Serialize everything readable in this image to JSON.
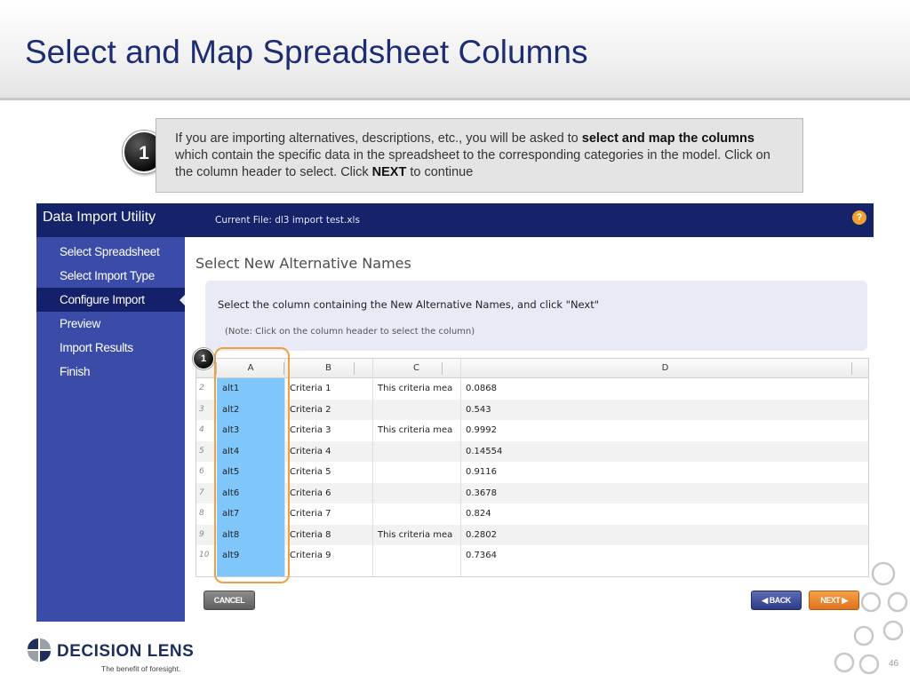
{
  "slide": {
    "title": "Select and Map Spreadsheet Columns",
    "step_number": "1",
    "page_number": "46"
  },
  "callout": {
    "text_1": "If you are importing alternatives, descriptions, etc., you will be asked to ",
    "bold_1": "select and map the columns",
    "text_2": " which contain the specific data in the spreadsheet to the corresponding categories in the model.  Click on the column header to select.  Click ",
    "bold_2": "NEXT",
    "text_3": " to continue"
  },
  "app": {
    "title": "Data Import Utility",
    "current_file": "Current File: dl3 import test.xls",
    "help_icon": "?",
    "sidebar": {
      "items": [
        {
          "label": "Select Spreadsheet"
        },
        {
          "label": "Select Import Type"
        },
        {
          "label": "Configure Import"
        },
        {
          "label": "Preview"
        },
        {
          "label": "Import Results"
        },
        {
          "label": "Finish"
        }
      ],
      "active_index": 2
    },
    "main": {
      "heading": "Select New Alternative Names",
      "instruction": "Select the column containing the New Alternative Names, and click \"Next\"",
      "note": "(Note: Click on the column header to select the column)"
    },
    "grid": {
      "columns": [
        "A",
        "B",
        "C",
        "D"
      ],
      "selected_column": "A",
      "rows": [
        {
          "num": "2",
          "A": "alt1",
          "B": "Criteria 1",
          "C": "This criteria mea",
          "D": "0.0868"
        },
        {
          "num": "3",
          "A": "alt2",
          "B": "Criteria 2",
          "C": "",
          "D": "0.543"
        },
        {
          "num": "4",
          "A": "alt3",
          "B": "Criteria 3",
          "C": "This criteria mea",
          "D": "0.9992"
        },
        {
          "num": "5",
          "A": "alt4",
          "B": "Criteria 4",
          "C": "",
          "D": "0.14554"
        },
        {
          "num": "6",
          "A": "alt5",
          "B": "Criteria 5",
          "C": "",
          "D": "0.9116"
        },
        {
          "num": "7",
          "A": "alt6",
          "B": "Criteria 6",
          "C": "",
          "D": "0.3678"
        },
        {
          "num": "8",
          "A": "alt7",
          "B": "Criteria 7",
          "C": "",
          "D": "0.824"
        },
        {
          "num": "9",
          "A": "alt8",
          "B": "Criteria 8",
          "C": "This criteria mea",
          "D": "0.2802"
        },
        {
          "num": "10",
          "A": "alt9",
          "B": "Criteria 9",
          "C": "",
          "D": "0.7364"
        }
      ]
    },
    "buttons": {
      "cancel": "CANCEL",
      "back": "◀ BACK",
      "next": "NEXT ▶"
    }
  },
  "branding": {
    "company": "DECISION LENS",
    "tagline": "The benefit of foresight."
  },
  "colors": {
    "title": "#1e2d73",
    "app_bar": "#16226a",
    "sidebar": "#3b4ca8",
    "selected_column": "#7fc6fa",
    "highlight": "#f0a040",
    "next_button": "#e1731c"
  }
}
